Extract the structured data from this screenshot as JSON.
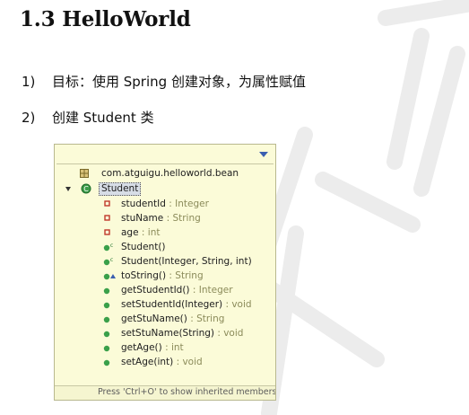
{
  "heading": "1.3 HelloWorld",
  "steps": [
    {
      "num": "1)",
      "text": "目标：使用 Spring 创建对象，为属性赋值"
    },
    {
      "num": "2)",
      "text": "创建 Student 类"
    }
  ],
  "outline": {
    "package": "com.atguigu.helloworld.bean",
    "class_name": "Student",
    "members": [
      {
        "name": "studentId",
        "type": " : Integer"
      },
      {
        "name": "stuName",
        "type": " : String"
      },
      {
        "name": "age",
        "type": " : int"
      },
      {
        "name": "Student()",
        "type": ""
      },
      {
        "name": "Student(Integer, String, int)",
        "type": ""
      },
      {
        "name": "toString()",
        "type": " : String"
      },
      {
        "name": "getStudentId()",
        "type": " : Integer"
      },
      {
        "name": "setStudentId(Integer)",
        "type": " : void"
      },
      {
        "name": "getStuName()",
        "type": " : String"
      },
      {
        "name": "setStuName(String)",
        "type": " : void"
      },
      {
        "name": "getAge()",
        "type": " : int"
      },
      {
        "name": "setAge(int)",
        "type": " : void"
      }
    ],
    "footer": "Press 'Ctrl+O' to show inherited members"
  },
  "colors": {
    "popup_bg": "#fbfbd8",
    "field_icon": "#c0392b",
    "method_icon": "#3aa04a",
    "class_icon": "#2f8f3f"
  }
}
